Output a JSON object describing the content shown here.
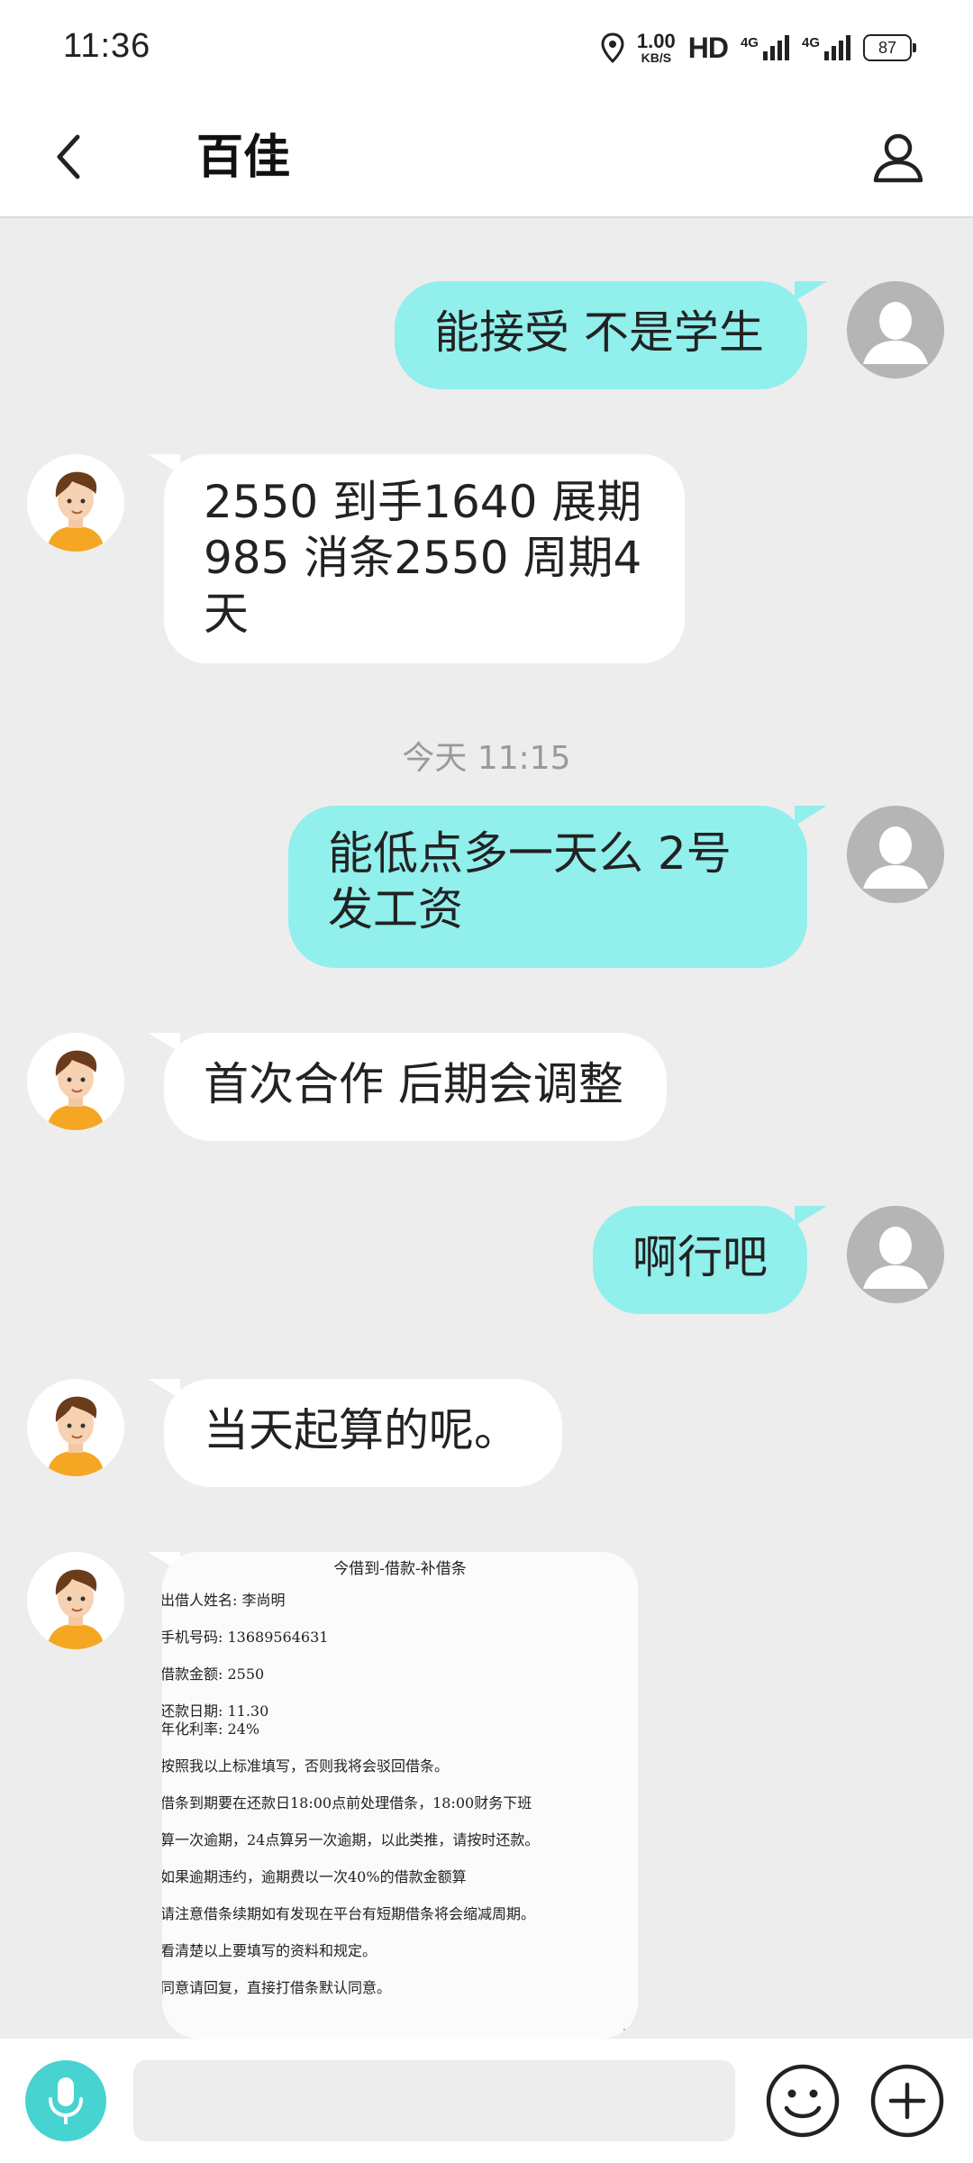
{
  "status_bar": {
    "time": "11:36",
    "net_speed_value": "1.00",
    "net_speed_unit": "KB/S",
    "hd_label": "HD",
    "sim1_net": "4G",
    "sim2_net": "4G",
    "battery": "87"
  },
  "header": {
    "title": "百佳"
  },
  "messages": [
    {
      "side": "me",
      "text": "能接受 不是学生"
    },
    {
      "side": "them",
      "text": "2550  到手1640  展期985   消条2550 周期4天"
    },
    {
      "side": "me",
      "text": "能低点多一天么 2号发工资"
    },
    {
      "side": "them",
      "text": "首次合作 后期会调整"
    },
    {
      "side": "me",
      "text": "啊行吧"
    },
    {
      "side": "them",
      "text": "当天起算的呢。"
    }
  ],
  "timestamp": "今天 11:15",
  "image_message": {
    "title": "今借到-借款-补借条",
    "lines": [
      "出借人姓名: 李尚明",
      "手机号码: 13689564631",
      "借款金额: 2550",
      "还款日期: 11.30",
      "年化利率: 24%",
      "按照我以上标准填写，否则我将会驳回借条。",
      "借条到期要在还款日18:00点前处理借条，18:00财务下班",
      "算一次逾期，24点算另一次逾期，以此类推，请按时还款。",
      "如果逾期违约，逾期费以一次40%的借款金额算",
      "请注意借条续期如有发现在平台有短期借条将会缩减周期。",
      "看清楚以上要填写的资料和规定。",
      "同意请回复，直接打借条默认同意。"
    ]
  },
  "input": {
    "value": "",
    "placeholder": ""
  },
  "icons": {
    "back": "back-arrow-icon",
    "profile": "profile-icon",
    "mic": "microphone-icon",
    "emoji": "emoji-icon",
    "plus": "plus-icon"
  },
  "colors": {
    "my_bubble": "#91efec",
    "their_bubble": "#ffffff",
    "chat_background": "#ededed",
    "accent": "#47d3d0"
  }
}
